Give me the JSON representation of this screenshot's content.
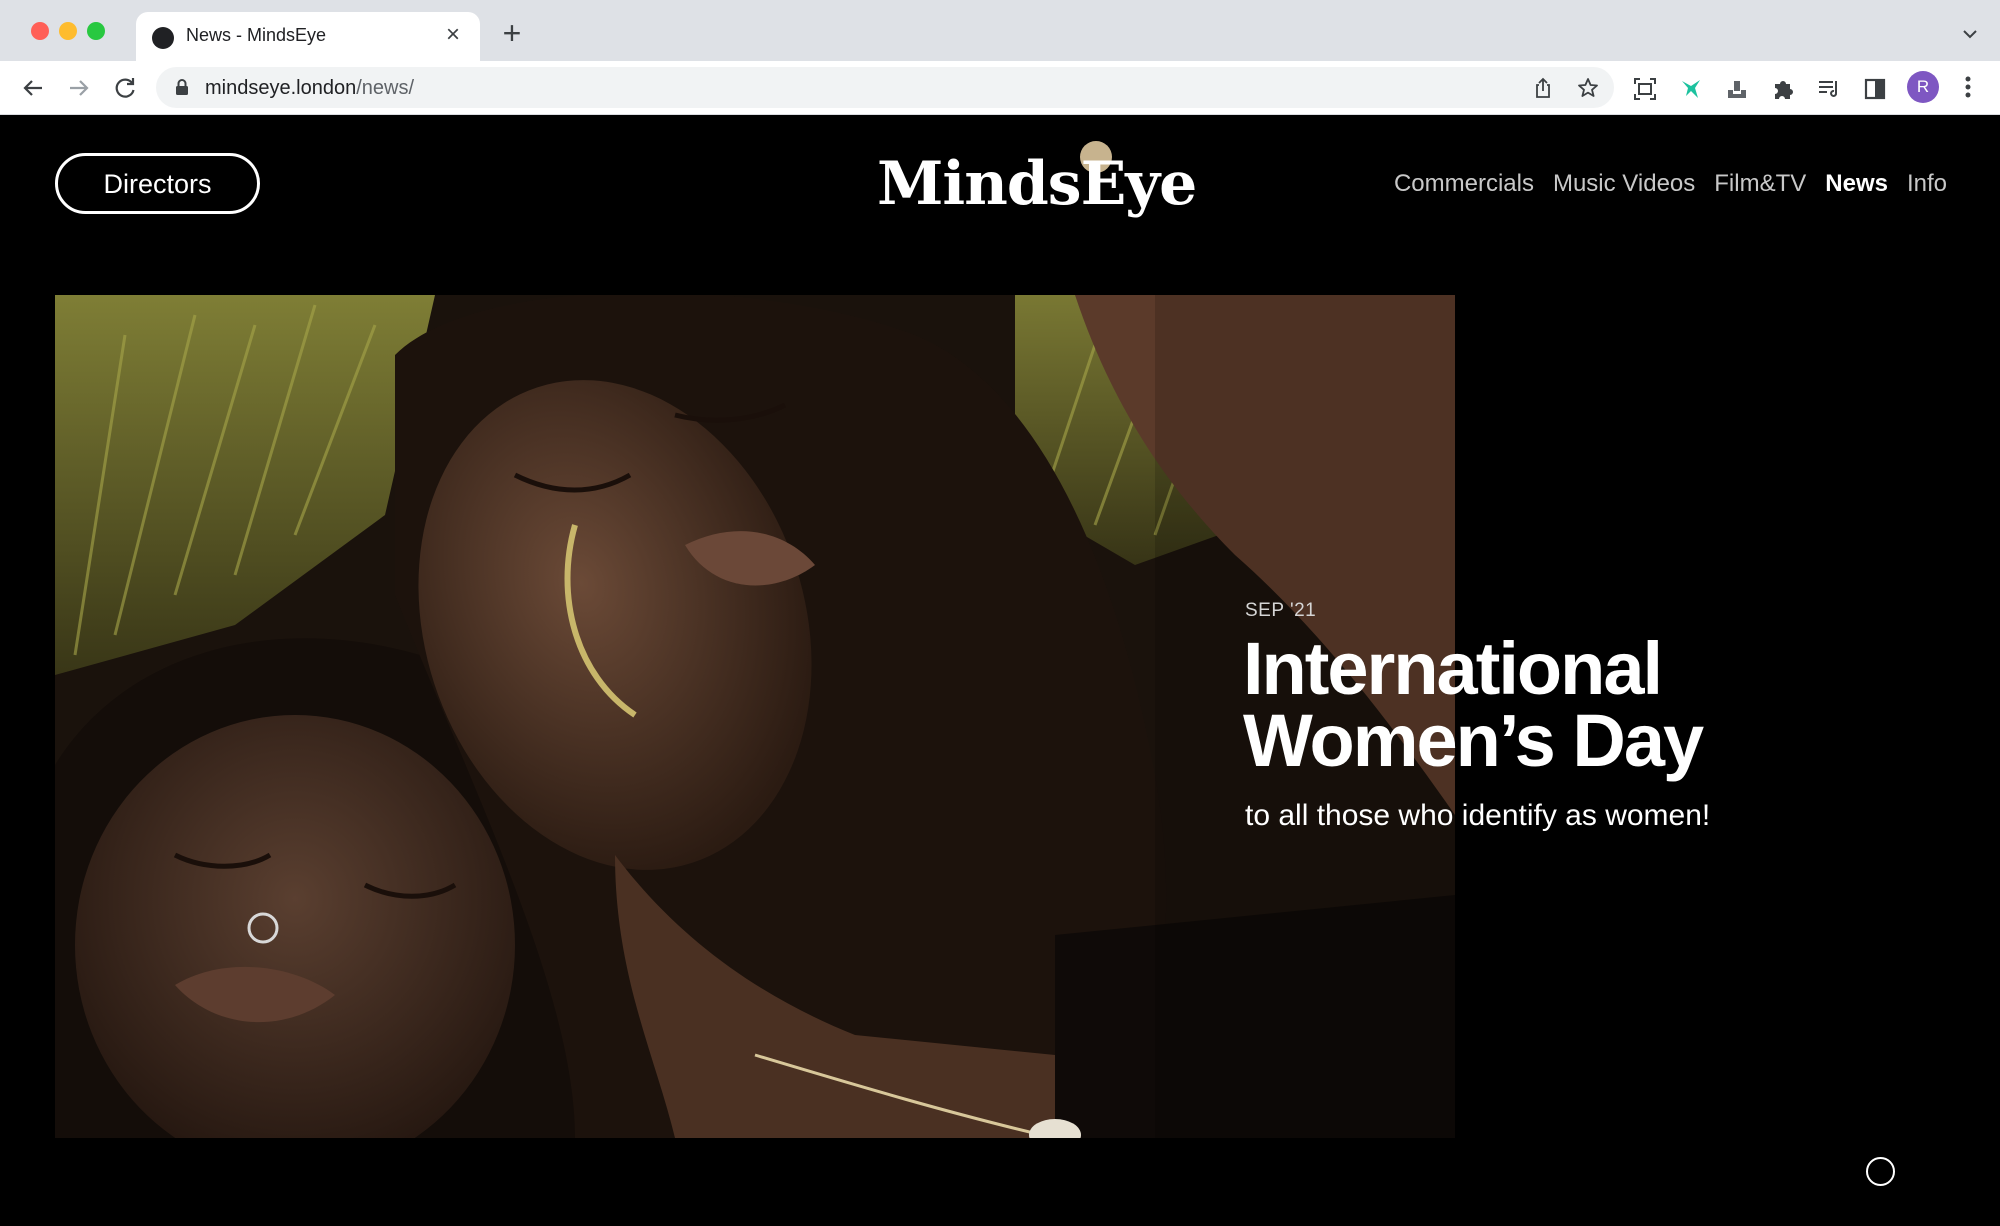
{
  "browser": {
    "tab_title": "News - MindsEye",
    "tab_close": "×",
    "new_tab": "+",
    "url_host": "mindseye.london",
    "url_path": "/news/",
    "profile_initial": "R"
  },
  "site": {
    "directors_label": "Directors",
    "logo": "MindsEye",
    "nav": [
      {
        "label": "Commercials"
      },
      {
        "label": "Music Videos"
      },
      {
        "label": "Film&TV"
      },
      {
        "label": "News"
      },
      {
        "label": "Info"
      }
    ]
  },
  "article": {
    "date": "SEP '21",
    "title_line1": "International",
    "title_line2": "Women’s Day",
    "subtitle": "to all those who identify as women!"
  },
  "colors": {
    "accent_dot": "#c7b38e",
    "page_bg": "#000000"
  }
}
